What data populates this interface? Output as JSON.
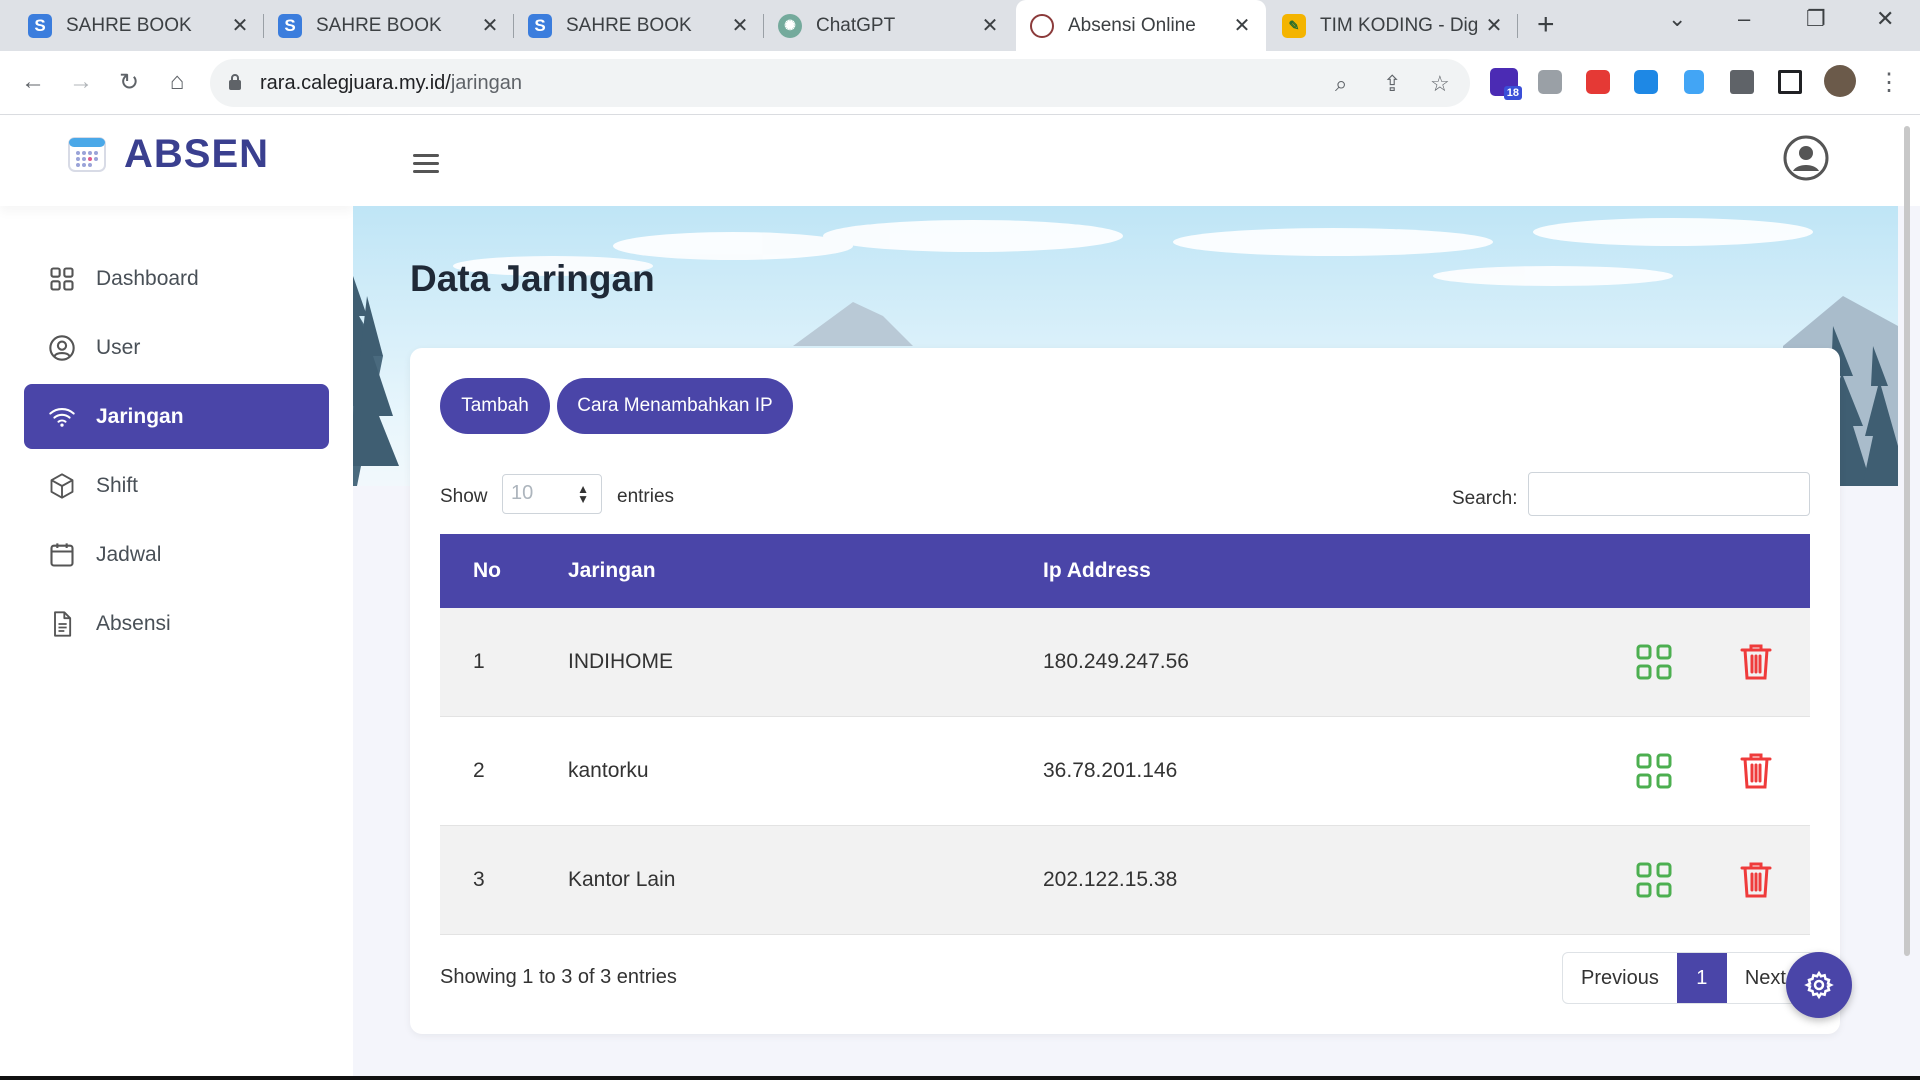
{
  "browser": {
    "tabs": [
      {
        "title": "SAHRE BOOK",
        "icon": "s-logo-icon"
      },
      {
        "title": "SAHRE BOOK",
        "icon": "s-logo-icon"
      },
      {
        "title": "SAHRE BOOK",
        "icon": "s-logo-icon"
      },
      {
        "title": "ChatGPT",
        "icon": "chatgpt-icon"
      },
      {
        "title": "Absensi Online",
        "icon": "site-favicon"
      },
      {
        "title": "TIM KODING - Dig",
        "icon": "timkoding-icon"
      }
    ],
    "url_host": "rara.calegjuara.my.id/",
    "url_path": "jaringan",
    "extension_badge": "18"
  },
  "app": {
    "brand": "ABSEN",
    "accent": "#4a45a8"
  },
  "sidebar": {
    "items": [
      {
        "label": "Dashboard",
        "icon": "grid-icon"
      },
      {
        "label": "User",
        "icon": "user-circle-icon"
      },
      {
        "label": "Jaringan",
        "icon": "wifi-icon",
        "active": true
      },
      {
        "label": "Shift",
        "icon": "box-icon"
      },
      {
        "label": "Jadwal",
        "icon": "calendar-icon"
      },
      {
        "label": "Absensi",
        "icon": "document-icon"
      }
    ]
  },
  "main": {
    "title": "Data Jaringan",
    "buttons": {
      "add": "Tambah",
      "howto": "Cara Menambahkan IP"
    },
    "length": {
      "show": "Show",
      "value": "10",
      "entries": "entries"
    },
    "search": {
      "label": "Search:",
      "value": ""
    },
    "table": {
      "headers": [
        "No",
        "Jaringan",
        "Ip Address"
      ],
      "rows": [
        {
          "no": "1",
          "name": "INDIHOME",
          "ip": "180.249.247.56"
        },
        {
          "no": "2",
          "name": "kantorku",
          "ip": "36.78.201.146"
        },
        {
          "no": "3",
          "name": "Kantor Lain",
          "ip": "202.122.15.38"
        }
      ]
    },
    "info": "Showing 1 to 3 of 3 entries",
    "pagination": {
      "previous": "Previous",
      "current": "1",
      "next": "Next"
    }
  }
}
